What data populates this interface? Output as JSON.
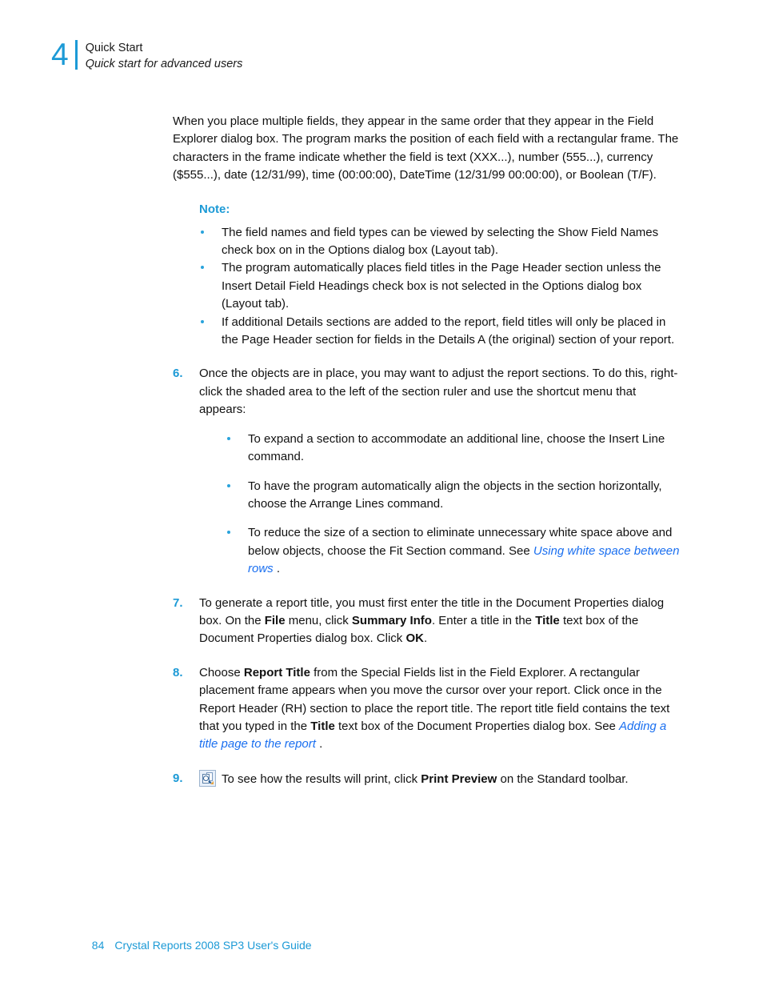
{
  "header": {
    "chapter_number": "4",
    "title": "Quick Start",
    "subtitle": "Quick start for advanced users"
  },
  "content": {
    "intro_paragraph": "When you place multiple fields, they appear in the same order that they appear in the Field Explorer dialog box. The program marks the position of each field with a rectangular frame. The characters in the frame indicate whether the field is text (XXX...), number (555...), currency ($555...), date (12/31/99), time (00:00:00), DateTime (12/31/99 00:00:00), or Boolean (T/F).",
    "note_heading": "Note:",
    "note_bullets": [
      "The field names and field types can be viewed by selecting the Show Field Names check box on in the Options dialog box (Layout tab).",
      "The program automatically places field titles in the Page Header section unless the Insert Detail Field Headings check box is not selected in the Options dialog box (Layout tab).",
      "If additional Details sections are added to the report, field titles will only be placed in the Page Header section for fields in the Details A (the original) section of your report."
    ],
    "steps": [
      {
        "number": "6.",
        "text": "Once the objects are in place, you may want to adjust the report sections. To do this, right-click the shaded area to the left of the section ruler and use the shortcut menu that appears:",
        "sub_bullets": [
          "To expand a section to accommodate an additional line, choose the Insert Line command.",
          "To have the program automatically align the objects in the section horizontally, choose the Arrange Lines command.",
          {
            "prefix": "To reduce the size of a section to eliminate unnecessary white space above and below objects, choose the Fit Section command. See ",
            "link": "Using white space between rows",
            "suffix": " ."
          }
        ]
      },
      {
        "number": "7.",
        "parts": [
          {
            "t": "To generate a report title, you must first enter the title in the Document Properties dialog box. On the "
          },
          {
            "t": "File",
            "b": true
          },
          {
            "t": " menu, click "
          },
          {
            "t": "Summary Info",
            "b": true
          },
          {
            "t": ". Enter a title in the "
          },
          {
            "t": "Title",
            "b": true
          },
          {
            "t": " text box of the Document Properties dialog box. Click "
          },
          {
            "t": "OK",
            "b": true
          },
          {
            "t": "."
          }
        ]
      },
      {
        "number": "8.",
        "parts": [
          {
            "t": "Choose "
          },
          {
            "t": "Report Title",
            "b": true
          },
          {
            "t": " from the Special Fields list in the Field Explorer. A rectangular placement frame appears when you move the cursor over your report. Click once in the Report Header (RH) section to place the report title. The report title field contains the text that you typed in the "
          },
          {
            "t": "Title",
            "b": true
          },
          {
            "t": " text box of the Document Properties dialog box. See "
          },
          {
            "t": "Adding a title page to the report",
            "link": true
          },
          {
            "t": " ."
          }
        ]
      },
      {
        "number": "9.",
        "icon": "print-preview-icon",
        "parts": [
          {
            "t": "To see how the results will print, click "
          },
          {
            "t": "Print Preview",
            "b": true
          },
          {
            "t": " on the Standard toolbar."
          }
        ]
      }
    ]
  },
  "footer": {
    "page_number": "84",
    "guide_title": "Crystal Reports 2008 SP3 User's Guide"
  },
  "colors": {
    "accent_blue": "#1C9AD6",
    "link_blue": "#1A6FF0",
    "bullet_blue": "#29A3DC",
    "text_black": "#111111"
  }
}
